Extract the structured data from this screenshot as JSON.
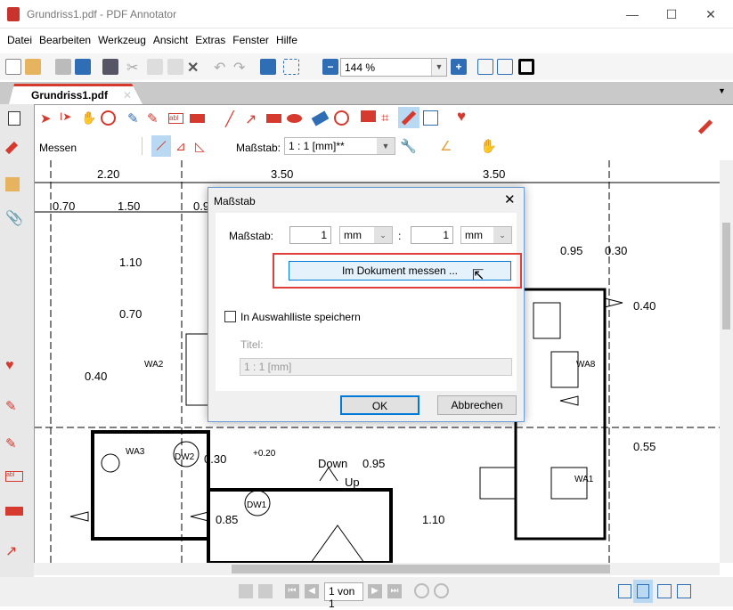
{
  "window": {
    "title": "Grundriss1.pdf - PDF Annotator",
    "minimize": "—",
    "maximize": "☐",
    "close": "✕"
  },
  "menu": [
    "Datei",
    "Bearbeiten",
    "Werkzeug",
    "Ansicht",
    "Extras",
    "Fenster",
    "Hilfe"
  ],
  "toolbar": {
    "zoom_value": "144 %"
  },
  "tab": {
    "label": "Grundriss1.pdf",
    "close": "✕"
  },
  "annotation_toolbar": {
    "mode_label": "Messen",
    "scale_label": "Maßstab:",
    "scale_value": "1 : 1 [mm]**"
  },
  "dialog": {
    "title": "Maßstab",
    "close": "✕",
    "scale_label": "Maßstab:",
    "value_left": "1",
    "unit_left": "mm",
    "separator": ":",
    "value_right": "1",
    "unit_right": "mm",
    "measure_button": "Im Dokument messen ...",
    "save_checkbox_label": "In Auswahlliste speichern",
    "save_checked": false,
    "title_label": "Titel:",
    "title_value": "1 : 1 [mm]",
    "ok": "OK",
    "cancel": "Abbrechen",
    "highlight_color": "#e0403a"
  },
  "plan": {
    "labels": [
      "2.20",
      "3.50",
      "3.50",
      "0.70",
      "1.50",
      "0.9",
      "1.10",
      "0.70",
      "0.40",
      "0.95",
      "0.30",
      "0.40",
      "0.55",
      "0.30",
      "0.95",
      "Down",
      "Up",
      "0.85",
      "1.10",
      "+0.20",
      "WA2",
      "WA3",
      "WA8",
      "WA1",
      "DW2",
      "DW1"
    ]
  },
  "status": {
    "page_indicator": "1 von 1"
  },
  "colors": {
    "accent": "#d63a2f",
    "selected": "#b9d9f2",
    "toolbar_blue": "#2f6db5"
  }
}
